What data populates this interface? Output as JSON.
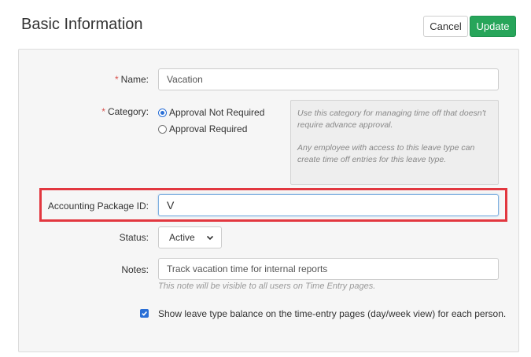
{
  "header": {
    "title": "Basic Information",
    "cancel_label": "Cancel",
    "update_label": "Update"
  },
  "form": {
    "name": {
      "required_mark": "*",
      "label": "Name:",
      "value": "Vacation"
    },
    "category": {
      "required_mark": "*",
      "label": "Category:",
      "options": [
        {
          "label": "Approval Not Required",
          "selected": true
        },
        {
          "label": "Approval Required",
          "selected": false
        }
      ],
      "help_p1": "Use this category for managing time off that doesn't require advance approval.",
      "help_p2": "Any employee with access to this leave type can create time off entries for this leave type."
    },
    "accounting": {
      "label": "Accounting Package ID:",
      "value": "V"
    },
    "status": {
      "label": "Status:",
      "value": "Active"
    },
    "notes": {
      "label": "Notes:",
      "value": "Track vacation time for internal reports",
      "hint": "This note will be visible to all users on Time Entry pages."
    },
    "show_balance": {
      "checked": true,
      "label": "Show leave type balance on the time-entry pages (day/week view) for each person."
    }
  },
  "colors": {
    "primary": "#27a55a",
    "highlight": "#e2373f",
    "required": "#d9534f",
    "accent_blue": "#2a6fd6"
  }
}
